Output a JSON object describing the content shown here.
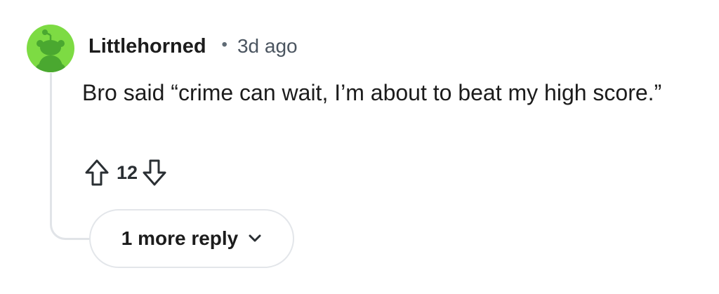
{
  "comment": {
    "username": "Littlehorned",
    "separator": "•",
    "timestamp": "3d ago",
    "text": "Bro said “crime can wait, I’m about to beat my high score.”",
    "votes": "12",
    "more_replies_label": "1 more reply",
    "avatar_icon": "snoo-avatar-icon",
    "colors": {
      "avatar_bg": "#7ddb43",
      "avatar_figure": "#4aa830",
      "thread_line": "#e1e4e8"
    }
  }
}
